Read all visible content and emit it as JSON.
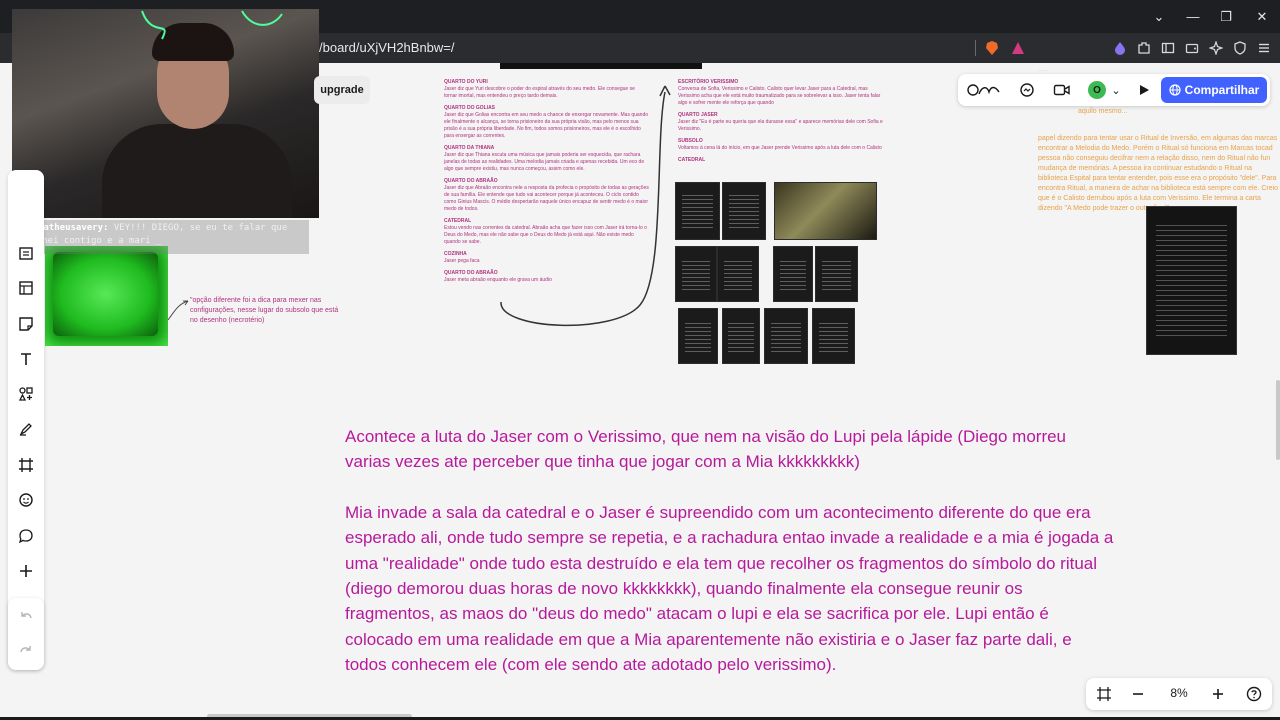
{
  "browser": {
    "url": "/board/uXjVH2hBnbw=/",
    "window_controls": [
      "⌄",
      "—",
      "❐",
      "✕"
    ]
  },
  "toolbar_top": {
    "upgrade_label": "upgrade"
  },
  "top_right": {
    "avatar_initial": "O",
    "share_label": "Compartilhar"
  },
  "chat": {
    "user": "matheusavery:",
    "message_line1": "VEY!!! DIEGO, se eu te falar que",
    "message_line2": "sonhei contigo e a mari _"
  },
  "annotation": "\"opção diferente foi a dica para mexer nas configurações, nesse lugar do subsolo que está no desenho (necrotério)",
  "orange_note": {
    "line0": "aquilo mesmo...",
    "body": "papel dizendo para tentar usar o Ritual de Inversão, em algumas das marcas encontrar a Melodia do Medo. Porém o Ritual só funciona em Marcas tocad pessoa não conseguiu decifrar nem a relação disso, nem do Ritual não fun mudança de memórias. A pessoa ira continuar estudando o Ritual na biblioteca Espital para tentar entender, pois esse era o propósito \"dele\". Para encontra Ritual, a maneira de achar na biblioteca está sempre com ele. Creio que é o Calisto derrubou após a luta com Verissimo. Ele termina a carta dizendo \"A Medo pode trazer o outro final\""
  },
  "notes_left": [
    {
      "h": "QUARTO DO YURI",
      "t": "Jaser diz que Yuri descobre o poder do espiral através do seu medo. Ele consegue se tornar imortal, mas entendeu o preço tardo demais."
    },
    {
      "h": "QUARTO DO GOLIAS",
      "t": "Jaser diz que Golias encontra em seu medo a chance de enxergar novamente. Mas quando ele finalmente o alcança, se torna prisioneiro da sua própria visão, mas pelo menos sua prisão é a sua própria liberdade. No fim, todos somos prisioneiros, mas ele é o escolhido para enxergar as correntes."
    },
    {
      "h": "QUARTO DA THIANA",
      "t": "Jaser diz que Thiana escuta uma música que jamais poderia ser esquecida, que rachara janelas de todas as realidades. Uma melodia jamais criada e apenas recebida. Um eco de algo que sempre existiu, mas nunca começou, assim como ele."
    },
    {
      "h": "QUARTO DO ABRAÃO",
      "t": "Jaser diz que Abraão encontra nele a resposta da profecia o propósito de todas as gerações de sua família. Ele entende que tudo vai acontecer porque já aconteceu. O ciclo contido como Ginius Mascis. O médio despertarão naquele único encapuz de sentir medo é o maior medo de todos."
    },
    {
      "h": "CATEDRAL",
      "t": "Estou vendo nas correntes da catedral. Abraão acha que fazer isso com Jaser irá torna-lo o Deus do Medo, mas ele não sabe que o Deus do Medo já está aqui. Não existe medo quando se sabe."
    },
    {
      "h": "COZINHA",
      "t": "Jaser pega faca"
    },
    {
      "h": "QUARTO DO ABRAÃO",
      "t": "Jaser meta abraão enquanto ele grava um áudio"
    }
  ],
  "notes_right": [
    {
      "h": "ESCRITÓRIO VERISSIMO",
      "t": "Conversa de Sofia, Verissimo e Calisto. Calisto quer levar Jaser para a Catedral, mas Verissimo acha que ele está muito traumatizado para se sobrelevar a isso. Jaser tenta falar algo e sofrer mente ele reforça que quando"
    },
    {
      "h": "QUARTO JASER",
      "t": "Jaser diz \"Eu é parte eu queria que ela durasse essa\" e aparece memórias dele com Sofia e Verissimo."
    },
    {
      "h": "SUBSOLO",
      "t": "Voltamos à cena lá do início, em que Jaser prende Verissimo após a luta dele com o Calisto"
    },
    {
      "h": "CATEDRAL",
      "t": ""
    }
  ],
  "main": {
    "p1": "Acontece a luta do Jaser com o Verissimo, que nem na visão do Lupi pela lápide (Diego morreu varias vezes ate perceber que tinha que jogar com a Mia kkkkkkkkk)",
    "p2": "Mia invade a sala da catedral e o Jaser é supreendido com um acontecimento diferente do que era esperado ali, onde tudo sempre se repetia, e a rachadura entao invade a realidade e a mia é jogada a uma \"realidade\" onde tudo esta destruído e ela tem que recolher os fragmentos do símbolo do ritual (diego demorou duas horas de novo kkkkkkkk), quando finalmente ela consegue reunir os fragmentos, as maos do \"deus do medo\" atacam o lupi e ela se sacrifica por ele. Lupi então é colocado em uma realidade em que a Mia aparentemente não existiria e o Jaser faz parte dali, e todos conhecem ele (com ele sendo ate adotado pelo verissimo)."
  },
  "zoom": {
    "value": "8%"
  },
  "icons": {
    "brave": "brave-icon",
    "share": "globe-icon"
  }
}
